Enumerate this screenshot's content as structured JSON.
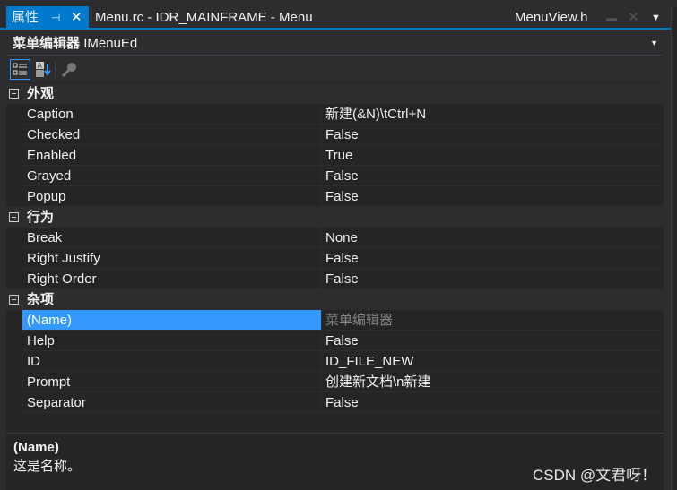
{
  "tabs": {
    "properties": "属性",
    "menu_doc": "Menu.rc - IDR_MAINFRAME - Menu",
    "menuview": "MenuView.h"
  },
  "object_selector": {
    "type": "菜单编辑器",
    "name": "IMenuEd"
  },
  "categories": [
    {
      "label": "外观",
      "props": [
        [
          "Caption",
          "新建(&N)\\tCtrl+N"
        ],
        [
          "Checked",
          "False"
        ],
        [
          "Enabled",
          "True"
        ],
        [
          "Grayed",
          "False"
        ],
        [
          "Popup",
          "False"
        ]
      ]
    },
    {
      "label": "行为",
      "props": [
        [
          "Break",
          "None"
        ],
        [
          "Right Justify",
          "False"
        ],
        [
          "Right Order",
          "False"
        ]
      ]
    },
    {
      "label": "杂项",
      "props": [
        [
          "(Name)",
          "菜单编辑器"
        ],
        [
          "Help",
          "False"
        ],
        [
          "ID",
          "ID_FILE_NEW"
        ],
        [
          "Prompt",
          "创建新文档\\n新建"
        ],
        [
          "Separator",
          "False"
        ]
      ]
    }
  ],
  "selected_property": "(Name)",
  "description": {
    "title": "(Name)",
    "text": "这是名称。"
  },
  "watermark": "CSDN @文君呀！"
}
